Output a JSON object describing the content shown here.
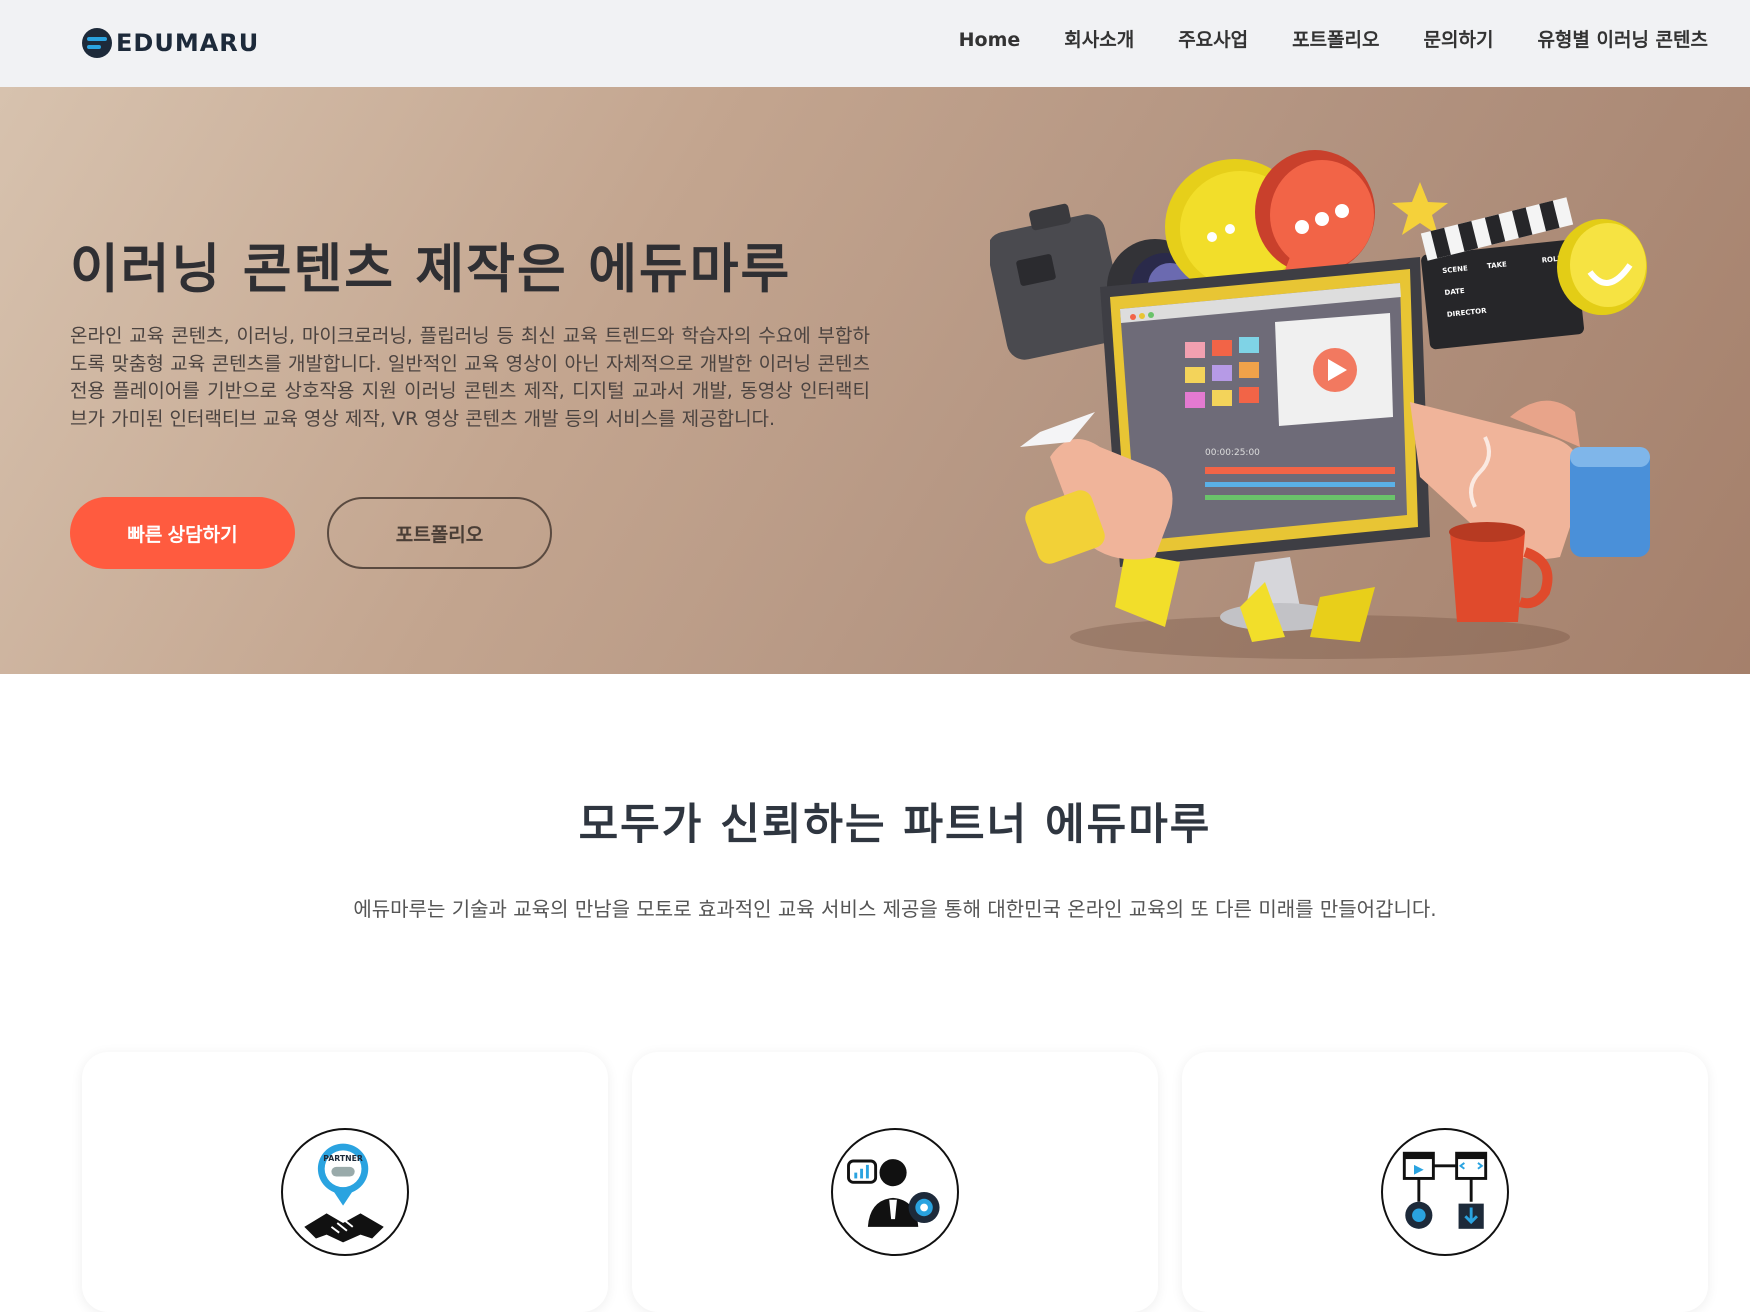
{
  "header": {
    "logo_text_a": "EDU",
    "logo_text_b": "MARU",
    "nav": [
      "Home",
      "회사소개",
      "주요사업",
      "포트폴리오",
      "문의하기",
      "유형별 이러닝 콘텐츠"
    ]
  },
  "hero": {
    "title": "이러닝 콘텐츠 제작은 에듀마루",
    "description": "온라인 교육 콘텐츠, 이러닝, 마이크로러닝, 플립러닝 등 최신 교육 트렌드와 학습자의 수요에 부합하도록 맞춤형 교육 콘텐츠를 개발합니다. 일반적인 교육 영상이 아닌 자체적으로 개발한 이러닝 콘텐츠 전용 플레이어를 기반으로 상호작용 지원 이러닝 콘텐츠 제작, 디지털 교과서 개발, 동영상 인터랙티브가 가미된 인터랙티브 교육 영상 제작, VR 영상 콘텐츠 개발 등의 서비스를 제공합니다.",
    "primary_button": "빠른 상담하기",
    "secondary_button": "포트폴리오",
    "illustration": {
      "screen_timecode": "00:00:25:00",
      "clapper_labels": [
        "SCENE",
        "TAKE",
        "ROLL",
        "DATE",
        "DIRECTOR"
      ]
    }
  },
  "partners": {
    "title": "모두가 신뢰하는 파트너 에듀마루",
    "description": "에듀마루는 기술과 교육의 만남을 모토로 효과적인 교육 서비스 제공을 통해 대한민국 온라인 교육의 또 다른 미래를 만들어갑니다.",
    "cards": [
      {
        "icon": "partner-handshake-icon",
        "badge": "PARTNER"
      },
      {
        "icon": "consultant-gear-icon"
      },
      {
        "icon": "development-flow-icon"
      }
    ]
  },
  "colors": {
    "accent": "#ff5b3f",
    "dark_text": "#2f3640",
    "header_bg": "#f1f2f4",
    "hero_bg": "#c3a58f"
  }
}
